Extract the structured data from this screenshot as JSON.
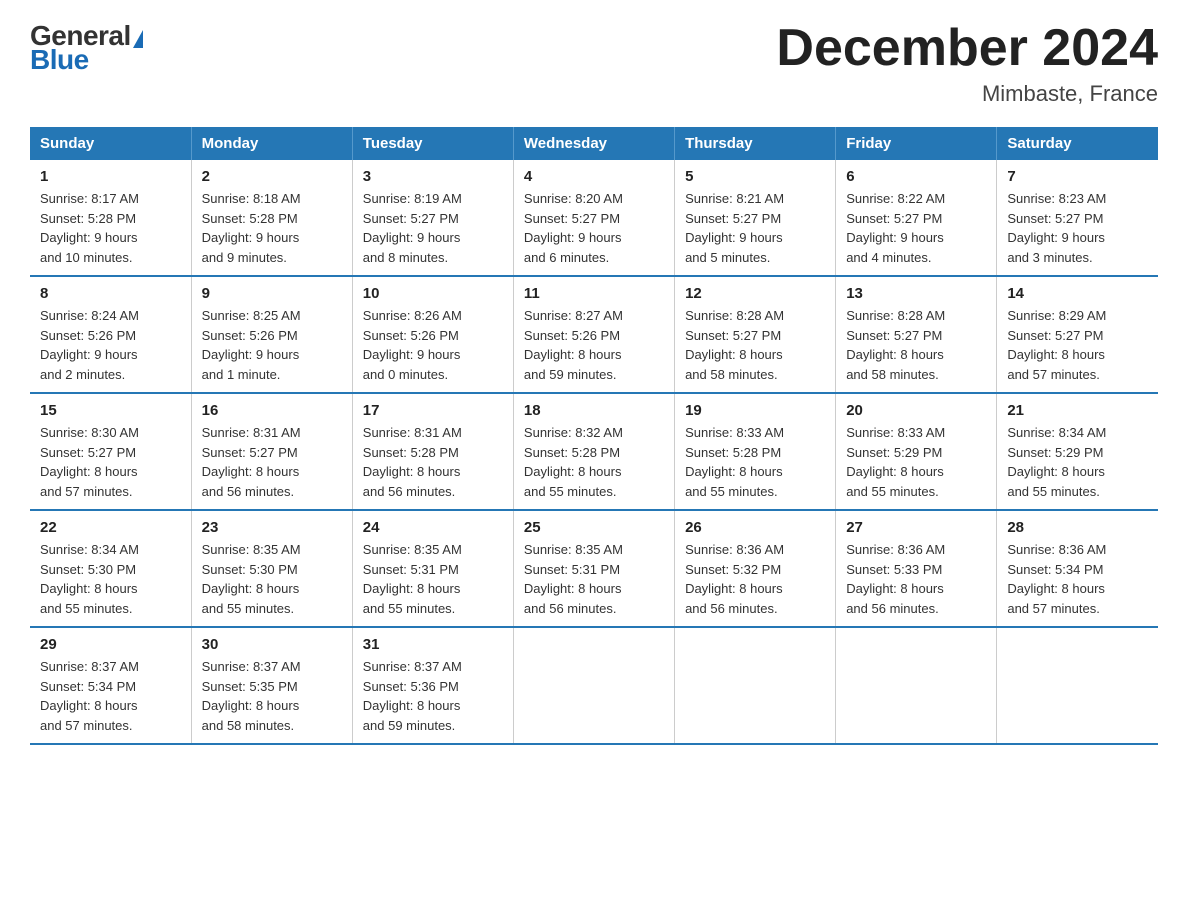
{
  "logo": {
    "general": "General",
    "blue": "Blue"
  },
  "header": {
    "title": "December 2024",
    "location": "Mimbaste, France"
  },
  "calendar": {
    "weekdays": [
      "Sunday",
      "Monday",
      "Tuesday",
      "Wednesday",
      "Thursday",
      "Friday",
      "Saturday"
    ],
    "weeks": [
      [
        {
          "day": "1",
          "sunrise": "8:17 AM",
          "sunset": "5:28 PM",
          "daylight": "9 hours and 10 minutes."
        },
        {
          "day": "2",
          "sunrise": "8:18 AM",
          "sunset": "5:28 PM",
          "daylight": "9 hours and 9 minutes."
        },
        {
          "day": "3",
          "sunrise": "8:19 AM",
          "sunset": "5:27 PM",
          "daylight": "9 hours and 8 minutes."
        },
        {
          "day": "4",
          "sunrise": "8:20 AM",
          "sunset": "5:27 PM",
          "daylight": "9 hours and 6 minutes."
        },
        {
          "day": "5",
          "sunrise": "8:21 AM",
          "sunset": "5:27 PM",
          "daylight": "9 hours and 5 minutes."
        },
        {
          "day": "6",
          "sunrise": "8:22 AM",
          "sunset": "5:27 PM",
          "daylight": "9 hours and 4 minutes."
        },
        {
          "day": "7",
          "sunrise": "8:23 AM",
          "sunset": "5:27 PM",
          "daylight": "9 hours and 3 minutes."
        }
      ],
      [
        {
          "day": "8",
          "sunrise": "8:24 AM",
          "sunset": "5:26 PM",
          "daylight": "9 hours and 2 minutes."
        },
        {
          "day": "9",
          "sunrise": "8:25 AM",
          "sunset": "5:26 PM",
          "daylight": "9 hours and 1 minute."
        },
        {
          "day": "10",
          "sunrise": "8:26 AM",
          "sunset": "5:26 PM",
          "daylight": "9 hours and 0 minutes."
        },
        {
          "day": "11",
          "sunrise": "8:27 AM",
          "sunset": "5:26 PM",
          "daylight": "8 hours and 59 minutes."
        },
        {
          "day": "12",
          "sunrise": "8:28 AM",
          "sunset": "5:27 PM",
          "daylight": "8 hours and 58 minutes."
        },
        {
          "day": "13",
          "sunrise": "8:28 AM",
          "sunset": "5:27 PM",
          "daylight": "8 hours and 58 minutes."
        },
        {
          "day": "14",
          "sunrise": "8:29 AM",
          "sunset": "5:27 PM",
          "daylight": "8 hours and 57 minutes."
        }
      ],
      [
        {
          "day": "15",
          "sunrise": "8:30 AM",
          "sunset": "5:27 PM",
          "daylight": "8 hours and 57 minutes."
        },
        {
          "day": "16",
          "sunrise": "8:31 AM",
          "sunset": "5:27 PM",
          "daylight": "8 hours and 56 minutes."
        },
        {
          "day": "17",
          "sunrise": "8:31 AM",
          "sunset": "5:28 PM",
          "daylight": "8 hours and 56 minutes."
        },
        {
          "day": "18",
          "sunrise": "8:32 AM",
          "sunset": "5:28 PM",
          "daylight": "8 hours and 55 minutes."
        },
        {
          "day": "19",
          "sunrise": "8:33 AM",
          "sunset": "5:28 PM",
          "daylight": "8 hours and 55 minutes."
        },
        {
          "day": "20",
          "sunrise": "8:33 AM",
          "sunset": "5:29 PM",
          "daylight": "8 hours and 55 minutes."
        },
        {
          "day": "21",
          "sunrise": "8:34 AM",
          "sunset": "5:29 PM",
          "daylight": "8 hours and 55 minutes."
        }
      ],
      [
        {
          "day": "22",
          "sunrise": "8:34 AM",
          "sunset": "5:30 PM",
          "daylight": "8 hours and 55 minutes."
        },
        {
          "day": "23",
          "sunrise": "8:35 AM",
          "sunset": "5:30 PM",
          "daylight": "8 hours and 55 minutes."
        },
        {
          "day": "24",
          "sunrise": "8:35 AM",
          "sunset": "5:31 PM",
          "daylight": "8 hours and 55 minutes."
        },
        {
          "day": "25",
          "sunrise": "8:35 AM",
          "sunset": "5:31 PM",
          "daylight": "8 hours and 56 minutes."
        },
        {
          "day": "26",
          "sunrise": "8:36 AM",
          "sunset": "5:32 PM",
          "daylight": "8 hours and 56 minutes."
        },
        {
          "day": "27",
          "sunrise": "8:36 AM",
          "sunset": "5:33 PM",
          "daylight": "8 hours and 56 minutes."
        },
        {
          "day": "28",
          "sunrise": "8:36 AM",
          "sunset": "5:34 PM",
          "daylight": "8 hours and 57 minutes."
        }
      ],
      [
        {
          "day": "29",
          "sunrise": "8:37 AM",
          "sunset": "5:34 PM",
          "daylight": "8 hours and 57 minutes."
        },
        {
          "day": "30",
          "sunrise": "8:37 AM",
          "sunset": "5:35 PM",
          "daylight": "8 hours and 58 minutes."
        },
        {
          "day": "31",
          "sunrise": "8:37 AM",
          "sunset": "5:36 PM",
          "daylight": "8 hours and 59 minutes."
        },
        null,
        null,
        null,
        null
      ]
    ],
    "labels": {
      "sunrise": "Sunrise:",
      "sunset": "Sunset:",
      "daylight": "Daylight:"
    }
  }
}
